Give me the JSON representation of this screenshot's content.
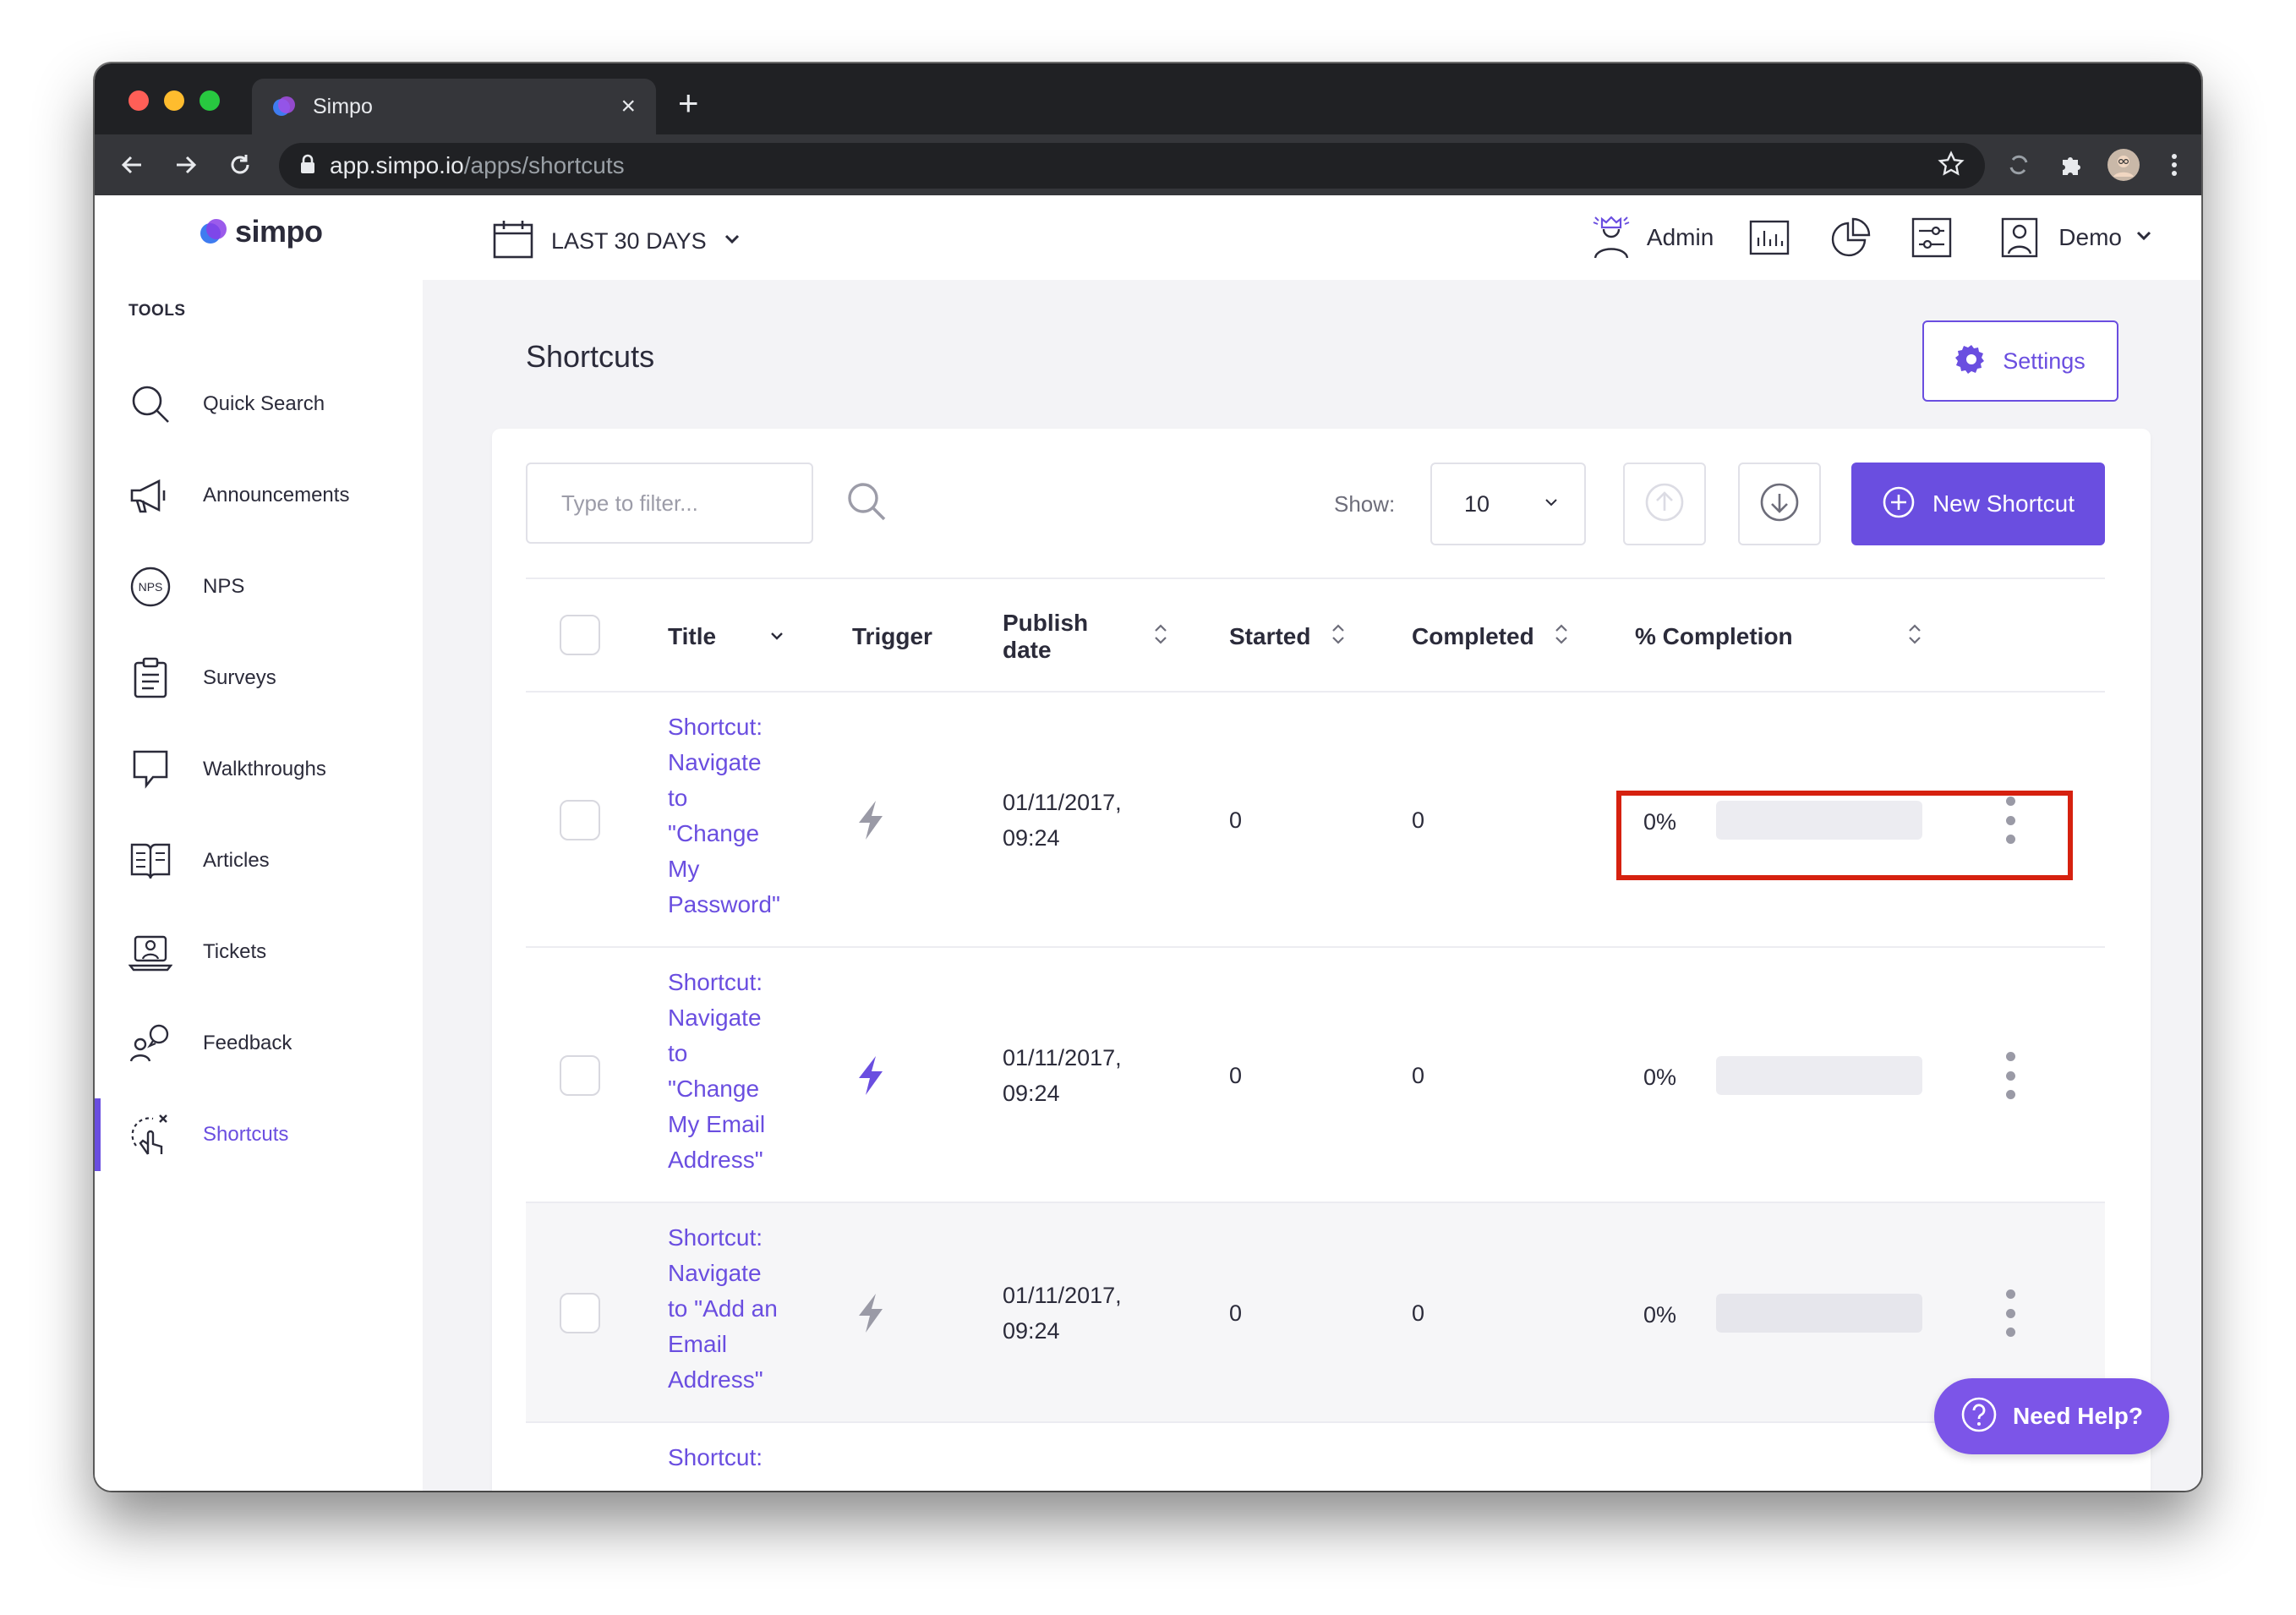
{
  "browser": {
    "tab_title": "Simpo",
    "tab_close": "×",
    "new_tab": "+",
    "url_host": "app.simpo.io",
    "url_path": "/apps/shortcuts"
  },
  "sidebar": {
    "brand": "simpo",
    "section": "TOOLS",
    "items": [
      {
        "label": "Quick Search",
        "icon": "search-icon"
      },
      {
        "label": "Announcements",
        "icon": "megaphone-icon"
      },
      {
        "label": "NPS",
        "icon": "nps-icon"
      },
      {
        "label": "Surveys",
        "icon": "clipboard-icon"
      },
      {
        "label": "Walkthroughs",
        "icon": "speech-bubble-icon"
      },
      {
        "label": "Articles",
        "icon": "book-icon"
      },
      {
        "label": "Tickets",
        "icon": "laptop-person-icon"
      },
      {
        "label": "Feedback",
        "icon": "people-chat-icon"
      },
      {
        "label": "Shortcuts",
        "icon": "tap-gesture-icon",
        "active": true
      }
    ]
  },
  "topbar": {
    "date_range": "LAST 30 DAYS",
    "admin_label": "Admin",
    "user_label": "Demo"
  },
  "page": {
    "title": "Shortcuts",
    "settings_label": "Settings"
  },
  "toolbar": {
    "filter_placeholder": "Type to filter...",
    "show_label": "Show:",
    "show_value": "10",
    "new_label": "New Shortcut"
  },
  "table": {
    "headers": {
      "title": "Title",
      "trigger": "Trigger",
      "publish_line1": "Publish",
      "publish_line2": "date",
      "started": "Started",
      "completed": "Completed",
      "completion": "% Completion"
    },
    "rows": [
      {
        "title_lines": [
          "Shortcut:",
          "Navigate",
          "to",
          "\"Change",
          "My",
          "Password\""
        ],
        "date": "01/11/2017,",
        "time": "09:24",
        "started": "0",
        "completed": "0",
        "percent": "0%",
        "progress": 0,
        "trigger_active": false
      },
      {
        "title_lines": [
          "Shortcut:",
          "Navigate",
          "to",
          "\"Change",
          "My Email",
          "Address\""
        ],
        "date": "01/11/2017,",
        "time": "09:24",
        "started": "0",
        "completed": "0",
        "percent": "0%",
        "progress": 0,
        "trigger_active": true
      },
      {
        "title_lines": [
          "Shortcut:",
          "Navigate",
          "to \"Add an",
          "Email",
          "Address\""
        ],
        "date": "01/11/2017,",
        "time": "09:24",
        "started": "0",
        "completed": "0",
        "percent": "0%",
        "progress": 0,
        "trigger_active": false
      },
      {
        "title_lines": [
          "Shortcut:"
        ]
      }
    ]
  },
  "help": {
    "label": "Need Help?"
  },
  "colors": {
    "accent": "#6a4ee0",
    "highlight": "#d6210f"
  }
}
